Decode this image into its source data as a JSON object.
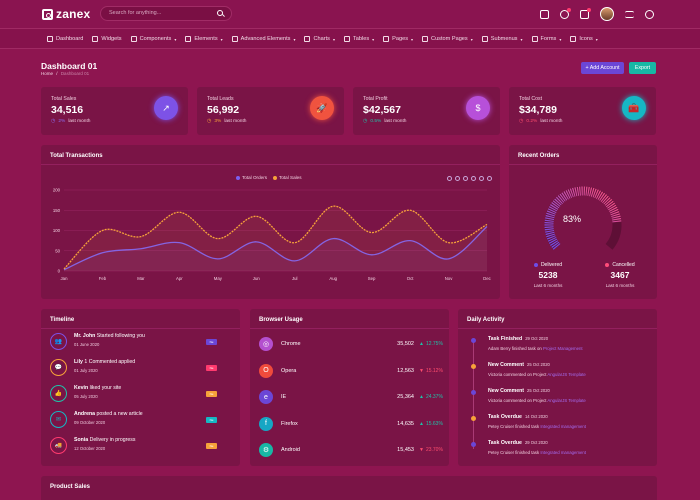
{
  "brand": {
    "name": "zanex"
  },
  "search": {
    "placeholder": "Search for anything..."
  },
  "menu": [
    {
      "label": "Dashboard"
    },
    {
      "label": "Widgets"
    },
    {
      "label": "Components"
    },
    {
      "label": "Elements"
    },
    {
      "label": "Advanced Elements"
    },
    {
      "label": "Charts"
    },
    {
      "label": "Tables"
    },
    {
      "label": "Pages"
    },
    {
      "label": "Custom Pages"
    },
    {
      "label": "Submenus"
    },
    {
      "label": "Forms"
    },
    {
      "label": "Icons"
    }
  ],
  "page": {
    "title": "Dashboard 01",
    "crumb_home": "Home",
    "crumb_sep": "/",
    "crumb_current": "Dashboard 01"
  },
  "buttons": {
    "add_account": "+ Add Account",
    "export": "Export"
  },
  "stats": [
    {
      "label": "Total Sales",
      "value": "34,516",
      "pct": "2%",
      "suffix": "last month",
      "pct_color": "#8c6cf0",
      "icon_bg": "#7d52e6"
    },
    {
      "label": "Total Leads",
      "value": "56,992",
      "pct": "3%",
      "suffix": "last month",
      "pct_color": "#f7a23a",
      "icon_bg": "#f0533f"
    },
    {
      "label": "Total Profit",
      "value": "$42,567",
      "pct": "0.5%",
      "suffix": "last month",
      "pct_color": "#1fc2a8",
      "icon_bg": "#b750d9"
    },
    {
      "label": "Total Cost",
      "value": "$34,789",
      "pct": "0.2%",
      "suffix": "last month",
      "pct_color": "#ff4d6e",
      "icon_bg": "#16b7c4"
    }
  ],
  "transactions": {
    "title": "Total Transactions",
    "chart_data": {
      "type": "line",
      "categories": [
        "Jan",
        "Feb",
        "Mar",
        "Apr",
        "May",
        "Jun",
        "Jul",
        "Aug",
        "Sep",
        "Oct",
        "Nov",
        "Dec"
      ],
      "ylim": [
        0,
        200
      ],
      "yticks": [
        "0",
        "50",
        "100",
        "150",
        "200"
      ],
      "series": [
        {
          "name": "Total Orders",
          "color": "#7b5ff0",
          "values": [
            3,
            45,
            55,
            70,
            30,
            72,
            25,
            80,
            40,
            75,
            30,
            110
          ]
        },
        {
          "name": "Total Sales",
          "color": "#f7a23a",
          "values": [
            5,
            100,
            85,
            145,
            80,
            135,
            70,
            160,
            95,
            150,
            70,
            115
          ]
        }
      ]
    }
  },
  "recent_orders": {
    "title": "Recent Orders",
    "pct": "83%",
    "gauge": 0.83,
    "delivered": {
      "label": "Delivered",
      "value": "5238",
      "sub": "Last 6 months",
      "color": "#6e4ce8"
    },
    "cancelled": {
      "label": "Cancelled",
      "value": "3467",
      "sub": "Last 6 months",
      "color": "#ff4d7a"
    }
  },
  "timeline": {
    "title": "Timeline",
    "items": [
      {
        "name": "Mr. John",
        "action": "Started following you",
        "date": "01 June 2020",
        "badge": "Ne",
        "badge_color": "#6b46d6",
        "icon": "👥",
        "icon_color": "#7d52e6"
      },
      {
        "name": "Lily",
        "action": "1 Commented applied",
        "date": "01 July 2020",
        "badge": "Ne",
        "badge_color": "#ff3a6e",
        "icon": "💬",
        "icon_color": "#f7a23a"
      },
      {
        "name": "Kevin",
        "action": "liked your site",
        "date": "05 July 2020",
        "badge": "Ne",
        "badge_color": "#f7a23a",
        "icon": "👍",
        "icon_color": "#1fc2a8"
      },
      {
        "name": "Andrena",
        "action": "posted a new article",
        "date": "09 October 2020",
        "badge": "Ne",
        "badge_color": "#16b7c4",
        "icon": "✉",
        "icon_color": "#16b7c4"
      },
      {
        "name": "Sonia",
        "action": "Delivery in progress",
        "date": "12 October 2020",
        "badge": "Ne",
        "badge_color": "#f7a23a",
        "icon": "🚚",
        "icon_color": "#ff3a6e"
      }
    ]
  },
  "browser": {
    "title": "Browser Usage",
    "items": [
      {
        "name": "Chrome",
        "value": "35,502",
        "pct": "12.75%",
        "up": true,
        "color": "#b44fcf",
        "glyph": "◎"
      },
      {
        "name": "Opera",
        "value": "12,563",
        "pct": "15.12%",
        "up": false,
        "color": "#ef4b3c",
        "glyph": "O"
      },
      {
        "name": "IE",
        "value": "25,364",
        "pct": "24.37%",
        "up": true,
        "color": "#6b46d6",
        "glyph": "e"
      },
      {
        "name": "Firefox",
        "value": "14,635",
        "pct": "15.63%",
        "up": true,
        "color": "#16a6c4",
        "glyph": "f"
      },
      {
        "name": "Android",
        "value": "15,453",
        "pct": "23.70%",
        "up": false,
        "color": "#18b7a5",
        "glyph": "⚙"
      }
    ]
  },
  "activity": {
    "title": "Daily Activity",
    "items": [
      {
        "title": "Task Finished",
        "date": "29 Oct 2020",
        "sub_pre": "Adam Berry finished task on",
        "sub_link": "Project Management",
        "color": "#6b46d6"
      },
      {
        "title": "New Comment",
        "date": "25 Oct 2020",
        "sub_pre": "Victoria commented on Project",
        "sub_link": "AngularJS Template",
        "color": "#f7a23a"
      },
      {
        "title": "New Comment",
        "date": "25 Oct 2020",
        "sub_pre": "Victoria commented on Project",
        "sub_link": "AngularJS Template",
        "color": "#6b46d6"
      },
      {
        "title": "Task Overdue",
        "date": "14 Oct 2020",
        "sub_pre": "Petey Cruiser finished task",
        "sub_link": "Integrated management",
        "color": "#f7a23a"
      },
      {
        "title": "Task Overdue",
        "date": "29 Oct 2020",
        "sub_pre": "Petey Cruiser finished task",
        "sub_link": "Integrated management",
        "color": "#6b46d6"
      }
    ]
  },
  "product_sales": {
    "title": "Product Sales"
  }
}
